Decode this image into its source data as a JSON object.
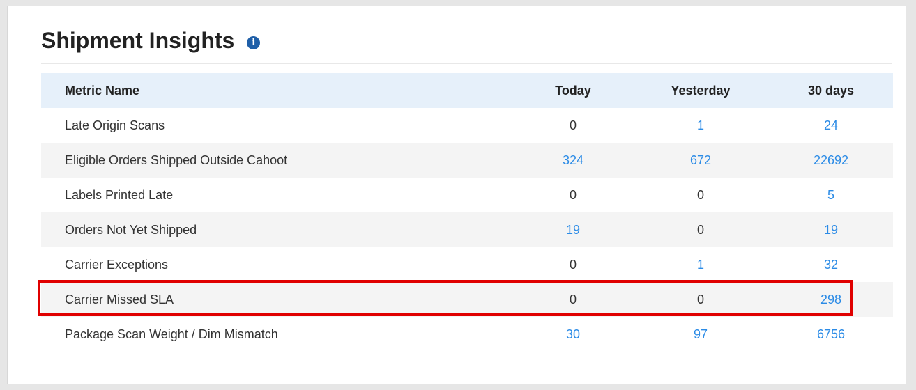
{
  "panel": {
    "title": "Shipment Insights",
    "info_icon": "info-icon"
  },
  "table": {
    "headers": {
      "metric": "Metric Name",
      "today": "Today",
      "yesterday": "Yesterday",
      "thirty_days": "30 days"
    },
    "rows": [
      {
        "metric": "Late Origin Scans",
        "today": "0",
        "yesterday": "1",
        "thirty_days": "24"
      },
      {
        "metric": "Eligible Orders Shipped Outside Cahoot",
        "today": "324",
        "yesterday": "672",
        "thirty_days": "22692"
      },
      {
        "metric": "Labels Printed Late",
        "today": "0",
        "yesterday": "0",
        "thirty_days": "5"
      },
      {
        "metric": "Orders Not Yet Shipped",
        "today": "19",
        "yesterday": "0",
        "thirty_days": "19"
      },
      {
        "metric": "Carrier Exceptions",
        "today": "0",
        "yesterday": "1",
        "thirty_days": "32"
      },
      {
        "metric": "Carrier Missed SLA",
        "today": "0",
        "yesterday": "0",
        "thirty_days": "298"
      },
      {
        "metric": "Package Scan Weight / Dim Mismatch",
        "today": "30",
        "yesterday": "97",
        "thirty_days": "6756"
      }
    ]
  },
  "colors": {
    "header_background": "#e6f0fa",
    "link": "#2b8be6",
    "highlight": "#e00000",
    "info_icon": "#1f5fa8"
  }
}
